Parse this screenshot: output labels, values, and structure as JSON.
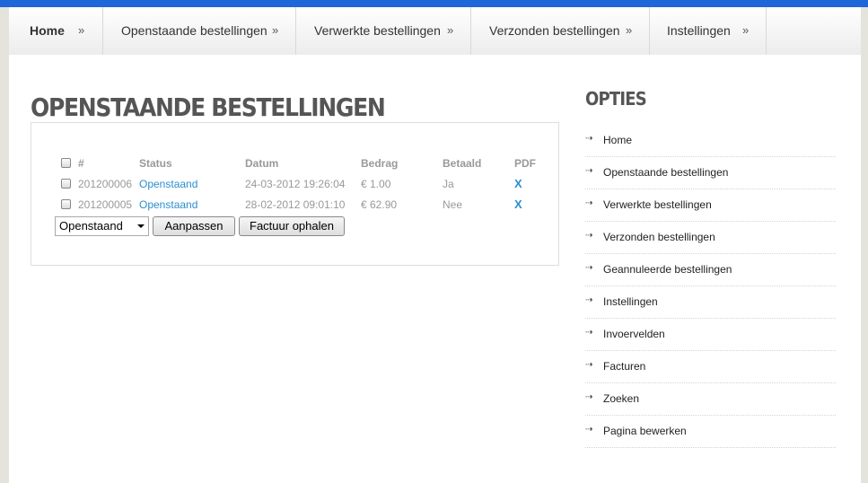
{
  "nav": {
    "items": [
      {
        "label": "Home",
        "arrow": "»"
      },
      {
        "label": "Openstaande bestellingen",
        "arrow": "»"
      },
      {
        "label": "Verwerkte bestellingen",
        "arrow": "»"
      },
      {
        "label": "Verzonden bestellingen",
        "arrow": "»"
      },
      {
        "label": "Instellingen",
        "arrow": "»"
      }
    ]
  },
  "main": {
    "title": "OPENSTAANDE BESTELLINGEN",
    "table": {
      "headers": {
        "num": "#",
        "status": "Status",
        "date": "Datum",
        "amount": "Bedrag",
        "paid": "Betaald",
        "pdf": "PDF"
      },
      "rows": [
        {
          "num": "201200006",
          "status": "Openstaand",
          "date": "24-03-2012 19:26:04",
          "amount": "€ 1.00",
          "paid": "Ja",
          "pdf": "X"
        },
        {
          "num": "201200005",
          "status": "Openstaand",
          "date": "28-02-2012 09:01:10",
          "amount": "€ 62.90",
          "paid": "Nee",
          "pdf": "X"
        }
      ]
    },
    "status_select": "Openstaand",
    "adjust_button": "Aanpassen",
    "invoice_button": "Factuur ophalen"
  },
  "sidebar": {
    "title": "OPTIES",
    "icon": "arrow-right-icon",
    "items": [
      {
        "label": "Home"
      },
      {
        "label": "Openstaande bestellingen"
      },
      {
        "label": "Verwerkte bestellingen"
      },
      {
        "label": "Verzonden bestellingen"
      },
      {
        "label": "Geannuleerde bestellingen"
      },
      {
        "label": "Instellingen"
      },
      {
        "label": "Invoervelden"
      },
      {
        "label": "Facturen"
      },
      {
        "label": "Zoeken"
      },
      {
        "label": "Pagina bewerken"
      }
    ]
  },
  "colors": {
    "accent": "#1f66d8",
    "link": "#2a8fcf"
  }
}
